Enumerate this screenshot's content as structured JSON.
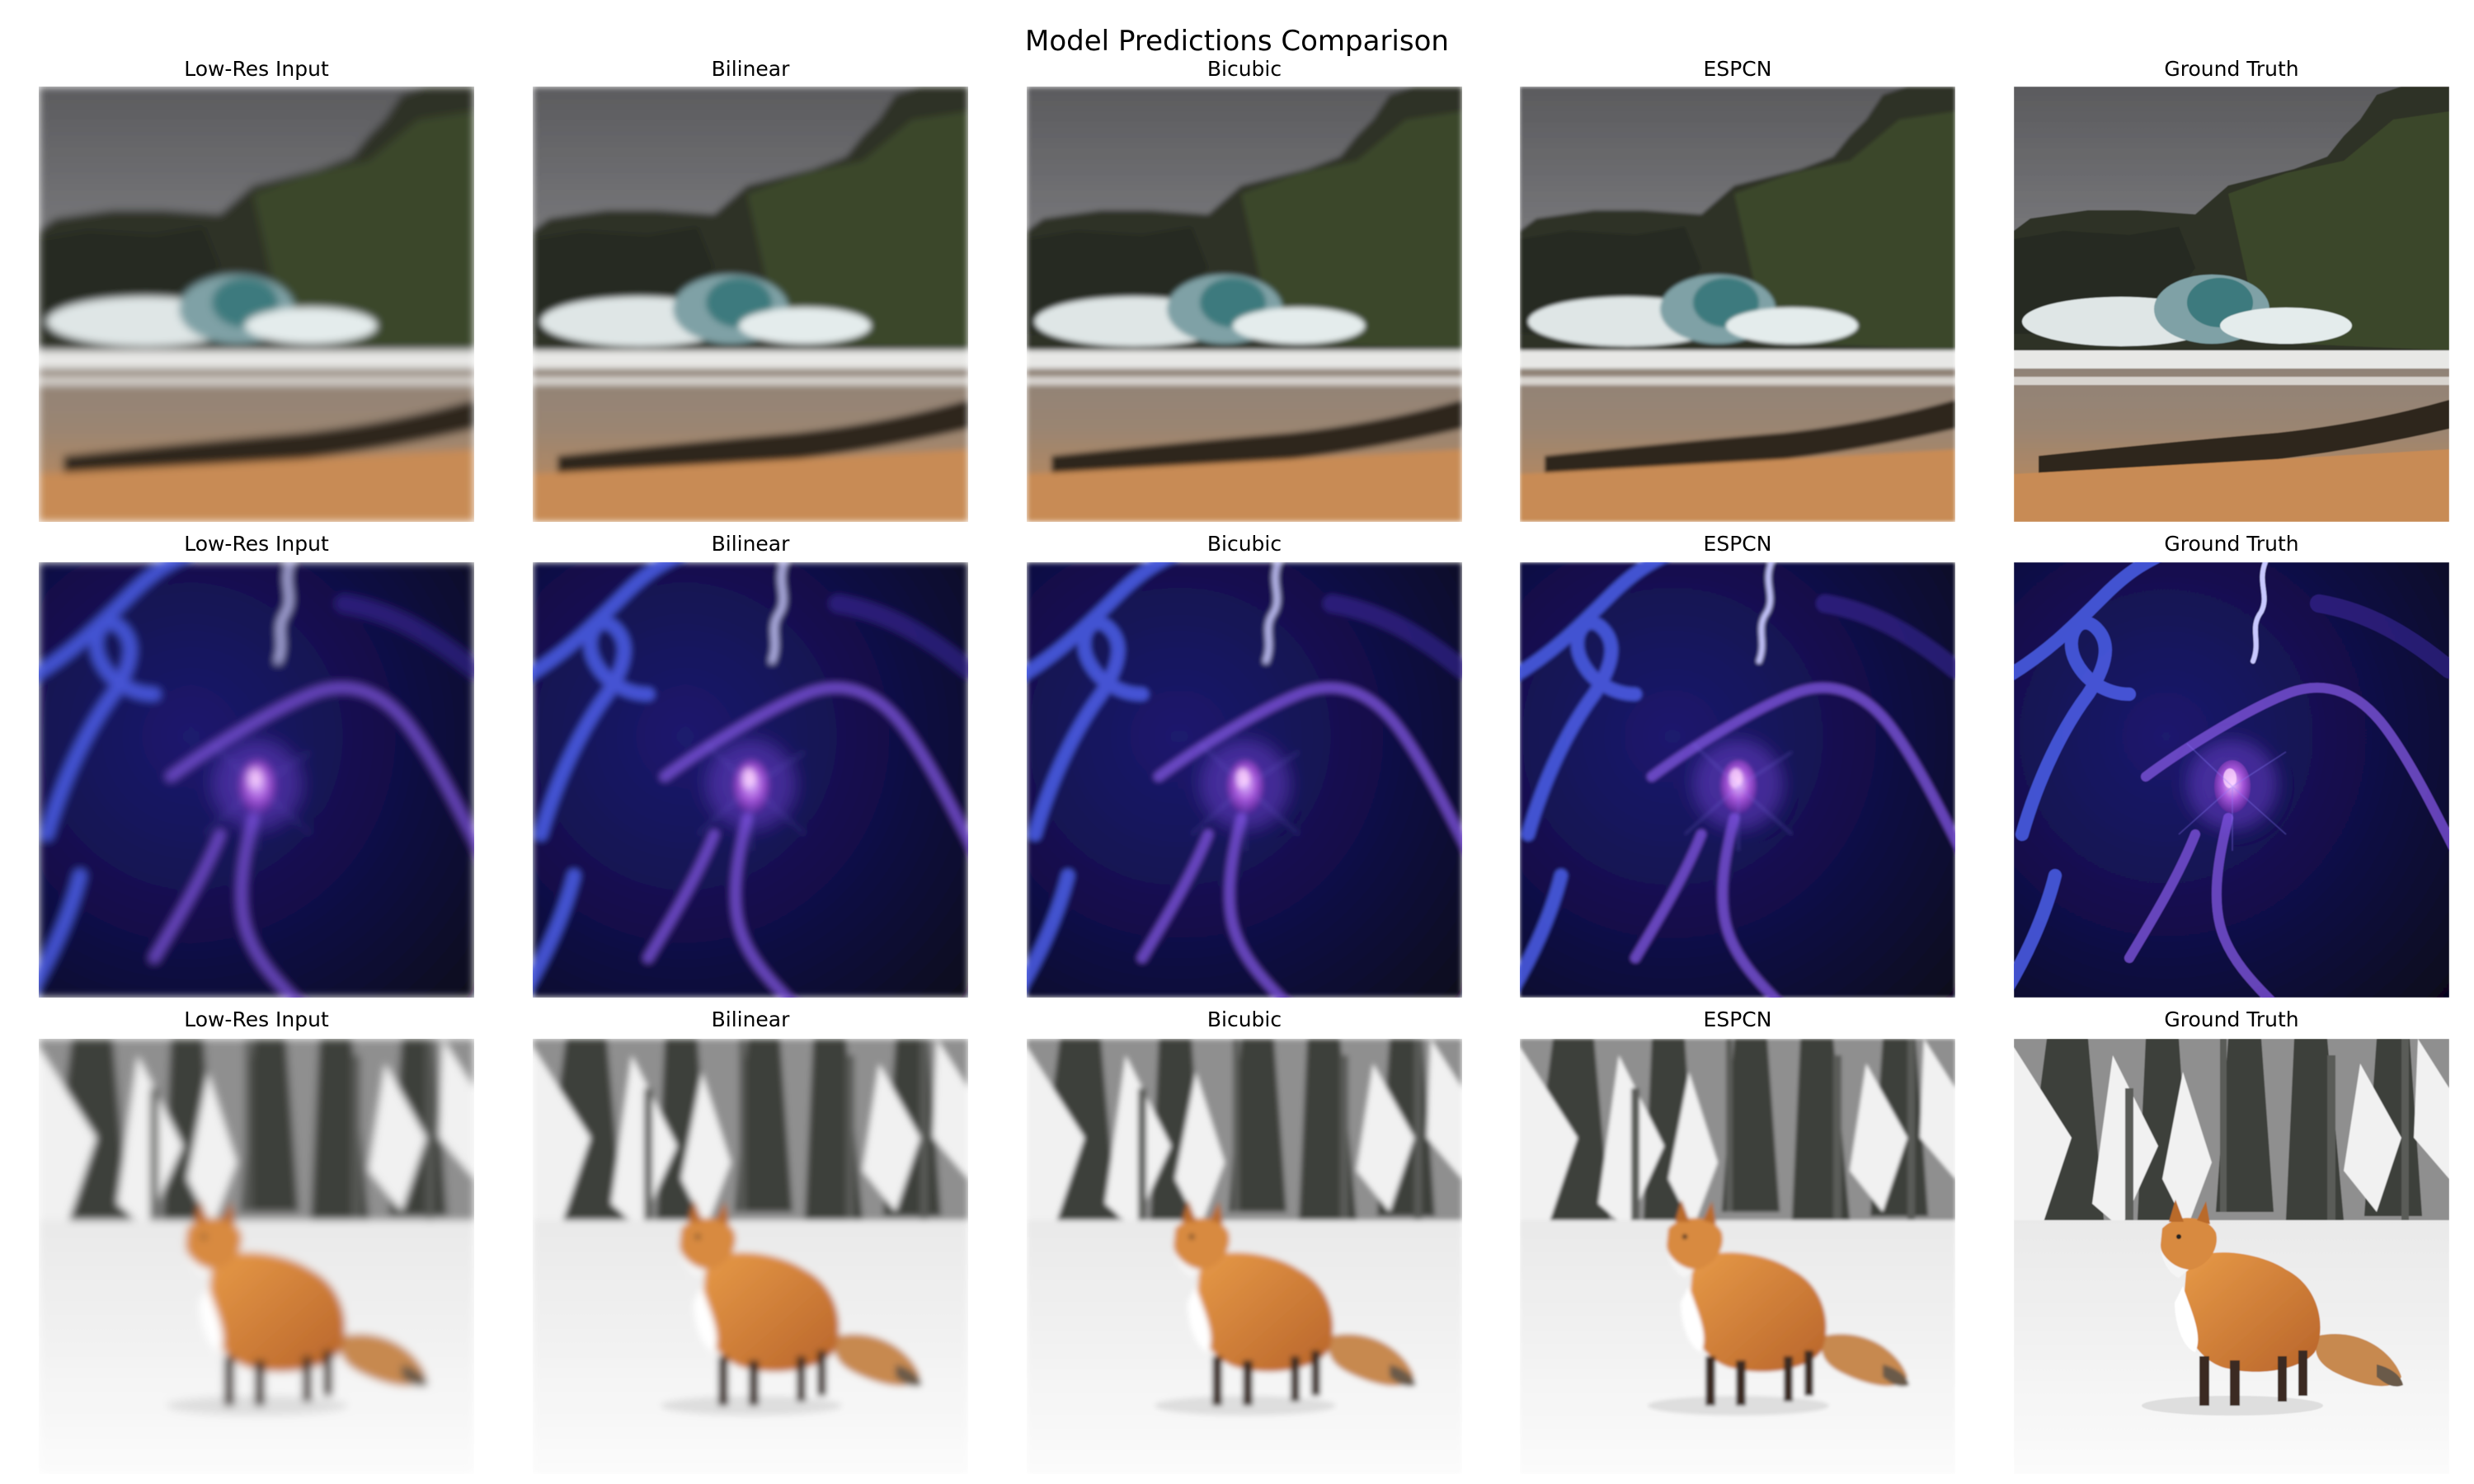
{
  "figure": {
    "title": "Model Predictions Comparison"
  },
  "columns": [
    "Low-Res Input",
    "Bilinear",
    "Bicubic",
    "ESPCN",
    "Ground Truth"
  ],
  "rows": [
    {
      "scene": "coastal-cliff-waves",
      "panels": [
        {
          "title": "Low-Res Input"
        },
        {
          "title": "Bilinear"
        },
        {
          "title": "Bicubic"
        },
        {
          "title": "ESPCN"
        },
        {
          "title": "Ground Truth"
        }
      ]
    },
    {
      "scene": "plasma-ball-blue",
      "panels": [
        {
          "title": "Low-Res Input"
        },
        {
          "title": "Bilinear"
        },
        {
          "title": "Bicubic"
        },
        {
          "title": "ESPCN"
        },
        {
          "title": "Ground Truth"
        }
      ]
    },
    {
      "scene": "red-fox-in-snowy-forest",
      "panels": [
        {
          "title": "Low-Res Input"
        },
        {
          "title": "Bilinear"
        },
        {
          "title": "Bicubic"
        },
        {
          "title": "ESPCN"
        },
        {
          "title": "Ground Truth"
        }
      ]
    }
  ]
}
